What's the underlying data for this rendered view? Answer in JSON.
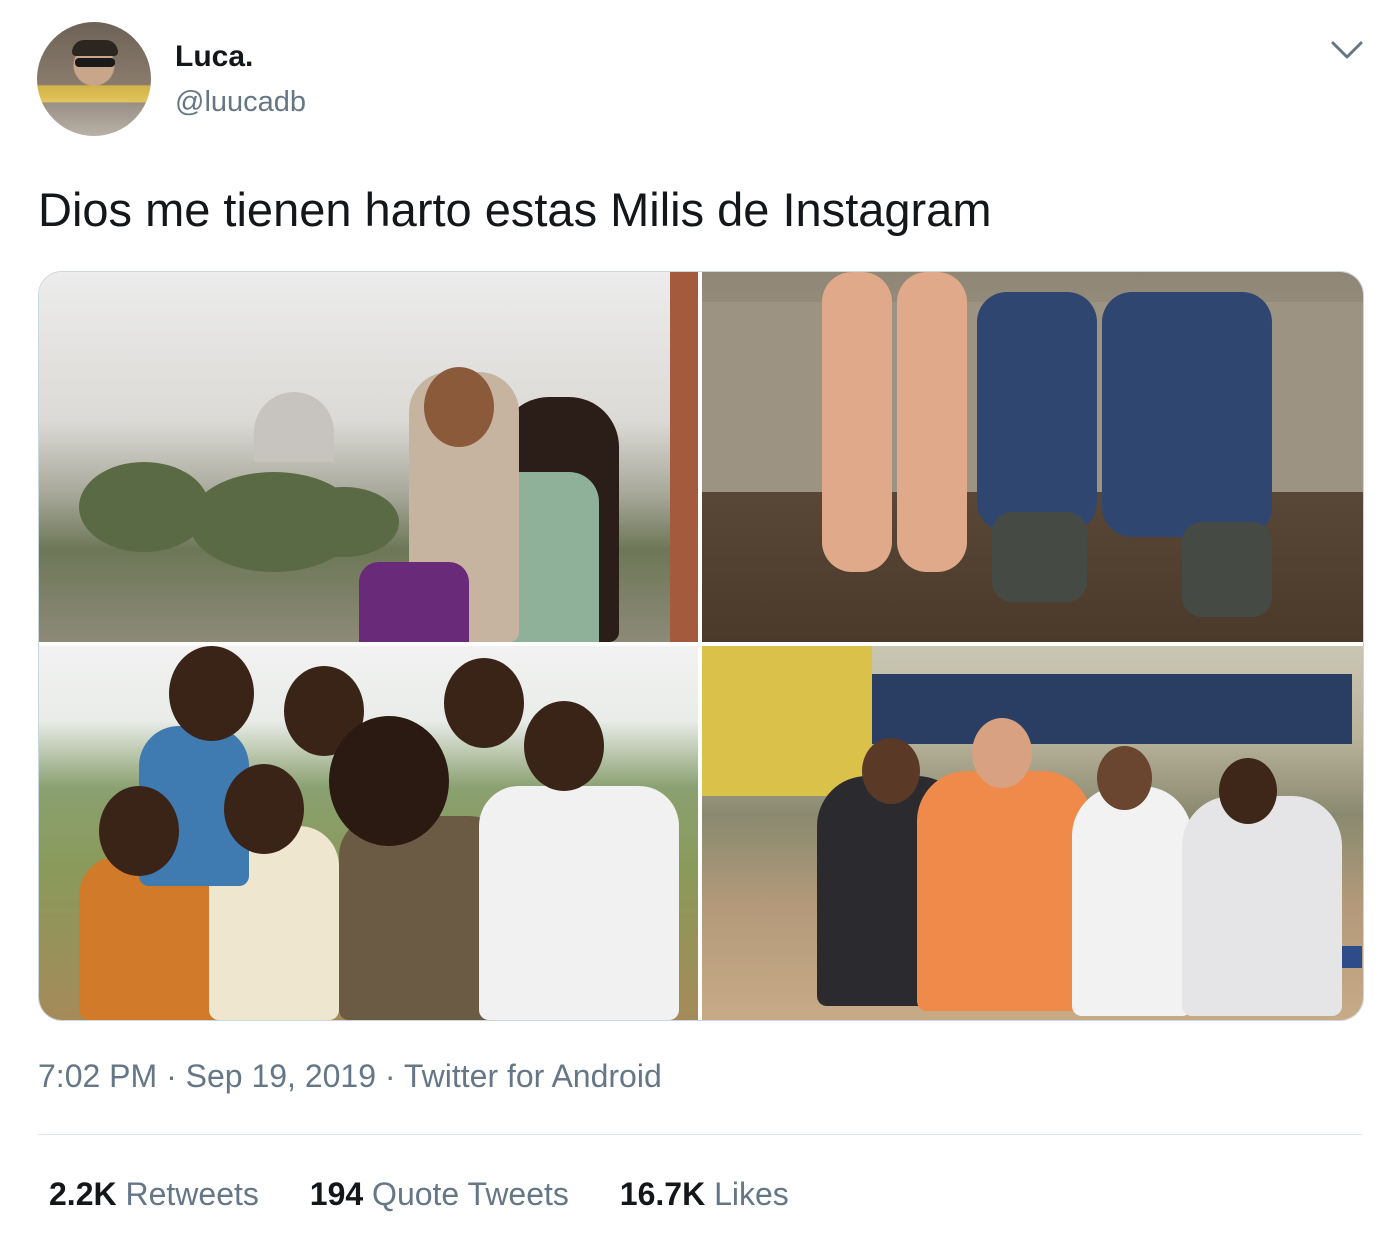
{
  "tweet": {
    "author": {
      "name": "Luca.",
      "handle": "@luucadb"
    },
    "text": "Dios me tienen harto estas Milis de Instagram",
    "media": {
      "photos": [
        {
          "label": ""
        },
        {
          "label": ""
        },
        {
          "label": ""
        },
        {
          "label": ""
        }
      ]
    },
    "meta": {
      "time": "7:02 PM",
      "sep1": " · ",
      "date": "Sep 19, 2019",
      "sep2": " · ",
      "source": "Twitter for Android"
    },
    "stats": {
      "retweets": {
        "count": "2.2K",
        "label": "Retweets"
      },
      "quotes": {
        "count": "194",
        "label": "Quote Tweets"
      },
      "likes": {
        "count": "16.7K",
        "label": "Likes"
      }
    }
  },
  "icons": {
    "more": "chevron-down-icon"
  },
  "colors": {
    "text_primary": "#14171a",
    "text_secondary": "#657786",
    "divider": "#e1e8ed"
  }
}
